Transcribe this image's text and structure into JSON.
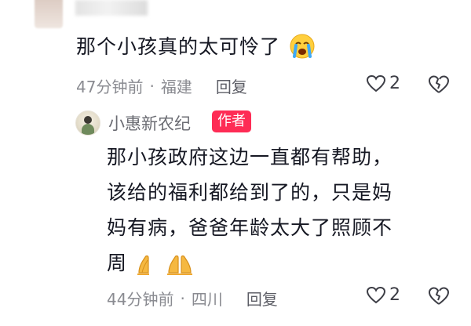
{
  "comment1": {
    "text": "那个小孩真的太可怜了",
    "emoji": "crying-face",
    "time": "47分钟前",
    "location": "福建",
    "reply_label": "回复",
    "likes": "2"
  },
  "comment2": {
    "username": "小惠新农纪",
    "badge": "作者",
    "lines": [
      "那小孩政府这边一直都有帮助，",
      "该给的福利都给到了的，只是妈",
      "妈有病，爸爸年龄太大了照顾不",
      "周"
    ],
    "emoji": "folded-hands",
    "time": "44分钟前",
    "location": "四川",
    "reply_label": "回复",
    "likes": "2"
  },
  "separator": "·",
  "colors": {
    "badge": "#fe2c55",
    "meta_text": "#8a8b91",
    "main_text": "#161823"
  }
}
